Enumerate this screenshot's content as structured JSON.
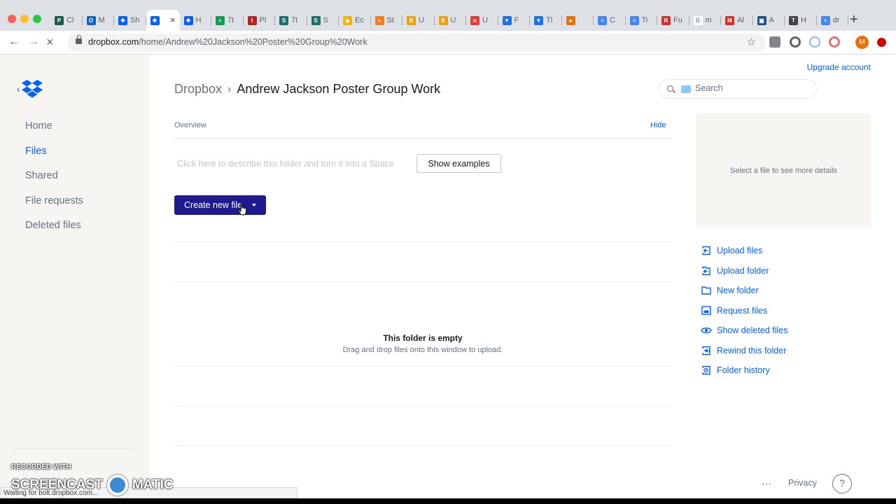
{
  "browser": {
    "tabs": [
      {
        "title": "Cl",
        "color": "#1f5c50",
        "glyph": "P"
      },
      {
        "title": "M",
        "color": "#0a66c2",
        "glyph": "O"
      },
      {
        "title": "Sh",
        "color": "#0061fe",
        "glyph": "❖"
      },
      {
        "title": "",
        "color": "#0061fe",
        "glyph": "❖",
        "active": true
      },
      {
        "title": "H",
        "color": "#0061fe",
        "glyph": "❖"
      },
      {
        "title": "7t",
        "color": "#0f9d58",
        "glyph": "+"
      },
      {
        "title": "Pl",
        "color": "#b3261e",
        "glyph": "I"
      },
      {
        "title": "7t",
        "color": "#1e6f6b",
        "glyph": "S"
      },
      {
        "title": "S",
        "color": "#1e6f6b",
        "glyph": "S"
      },
      {
        "title": "Ec",
        "color": "#f4b400",
        "glyph": "◆"
      },
      {
        "title": "St",
        "color": "#f47c20",
        "glyph": "≈"
      },
      {
        "title": "U",
        "color": "#f29f05",
        "glyph": "B"
      },
      {
        "title": "U",
        "color": "#f29f05",
        "glyph": "B"
      },
      {
        "title": "U",
        "color": "#e53935",
        "glyph": "n"
      },
      {
        "title": "F",
        "color": "#1a73e8",
        "glyph": "▼"
      },
      {
        "title": "Tl",
        "color": "#1a73e8",
        "glyph": "▼"
      },
      {
        "title": "",
        "color": "#e8710a",
        "glyph": "●"
      },
      {
        "title": "C",
        "color": "#4285f4",
        "glyph": "≡"
      },
      {
        "title": "Ti",
        "color": "#4285f4",
        "glyph": "≡"
      },
      {
        "title": "Fu",
        "color": "#d32f2f",
        "glyph": "R"
      },
      {
        "title": "m",
        "color": "#ffffff",
        "glyph": "G"
      },
      {
        "title": "Al",
        "color": "#d93025",
        "glyph": "M"
      },
      {
        "title": "A",
        "color": "#1a4e8a",
        "glyph": "▣"
      },
      {
        "title": "H",
        "color": "#444444",
        "glyph": "T"
      },
      {
        "title": "dr",
        "color": "#4285f4",
        "glyph": "≡"
      }
    ],
    "url_host": "dropbox.com",
    "url_path": "/home/Andrew%20Jackson%20Poster%20Group%20Work",
    "new_tab": "+",
    "back": "←",
    "forward": "→",
    "reload": "×",
    "star": "☆",
    "profile_initial": "M",
    "status_text": "Waiting for bolt.dropbox.com..."
  },
  "sidebar": {
    "items": [
      {
        "label": "Home",
        "key": "home",
        "active": false
      },
      {
        "label": "Files",
        "key": "files",
        "active": true
      },
      {
        "label": "Shared",
        "key": "shared",
        "active": false
      },
      {
        "label": "File requests",
        "key": "file-requests",
        "active": false
      },
      {
        "label": "Deleted files",
        "key": "deleted-files",
        "active": false
      }
    ]
  },
  "header": {
    "upgrade": "Upgrade account",
    "breadcrumb_root": "Dropbox",
    "breadcrumb_sep": "›",
    "breadcrumb_current": "Andrew Jackson Poster Group Work",
    "search_placeholder": "Search"
  },
  "overview": {
    "label": "Overview",
    "hide": "Hide",
    "describe_placeholder": "Click here to describe this folder and turn it into a Space",
    "show_examples": "Show examples"
  },
  "create": {
    "label": "Create new file"
  },
  "empty": {
    "title": "This folder is empty",
    "subtitle": "Drag and drop files onto this window to upload."
  },
  "details": {
    "text": "Select a file to see more details"
  },
  "actions": [
    {
      "label": "Upload files",
      "icon": "upload-files-icon"
    },
    {
      "label": "Upload folder",
      "icon": "upload-folder-icon"
    },
    {
      "label": "New folder",
      "icon": "new-folder-icon"
    },
    {
      "label": "Request files",
      "icon": "request-files-icon"
    },
    {
      "label": "Show deleted files",
      "icon": "eye-icon"
    },
    {
      "label": "Rewind this folder",
      "icon": "rewind-icon"
    },
    {
      "label": "Folder history",
      "icon": "folder-history-icon"
    }
  ],
  "footer": {
    "more": "⋯",
    "privacy": "Privacy",
    "help": "?"
  },
  "watermark": {
    "top": "RECORDED WITH",
    "left": "SCREENCAST",
    "right": "MATIC"
  },
  "colors": {
    "accent": "#0061fe",
    "create_button": "#1f1b8f",
    "sidebar_bg": "#f7f5f2"
  }
}
